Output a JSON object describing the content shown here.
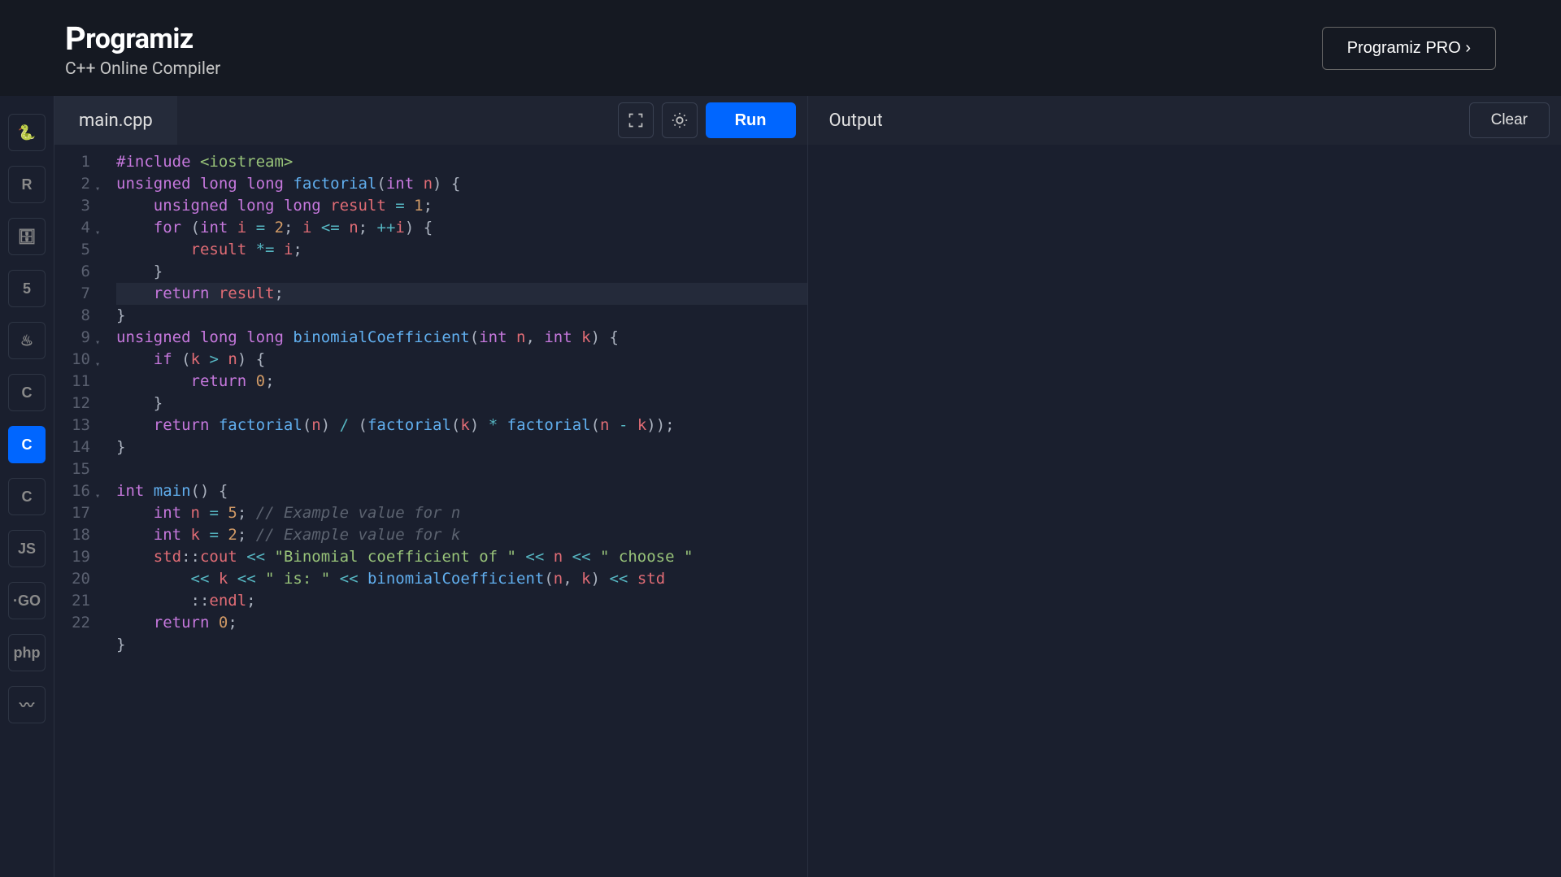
{
  "header": {
    "logo_text": "Programiz",
    "subtitle": "C++ Online Compiler",
    "pro_button": "Programiz PRO ›"
  },
  "sidebar": {
    "languages": [
      {
        "id": "python",
        "glyph": "🐍",
        "active": false
      },
      {
        "id": "r",
        "glyph": "R",
        "active": false
      },
      {
        "id": "sql",
        "glyph": "🗄",
        "active": false
      },
      {
        "id": "html",
        "glyph": "5",
        "active": false
      },
      {
        "id": "java",
        "glyph": "♨",
        "active": false
      },
      {
        "id": "c",
        "glyph": "C",
        "active": false
      },
      {
        "id": "cpp",
        "glyph": "C",
        "active": true
      },
      {
        "id": "csharp",
        "glyph": "C",
        "active": false
      },
      {
        "id": "js",
        "glyph": "JS",
        "active": false
      },
      {
        "id": "go",
        "glyph": "·GO",
        "active": false
      },
      {
        "id": "php",
        "glyph": "php",
        "active": false
      },
      {
        "id": "swift",
        "glyph": "〰",
        "active": false
      }
    ]
  },
  "editor": {
    "filename": "main.cpp",
    "run_label": "Run",
    "line_count": 22,
    "highlighted_line": 7,
    "fold_lines": [
      2,
      4,
      9,
      10,
      16
    ],
    "code_tokens": [
      [
        [
          "tok-pp",
          "#include"
        ],
        [
          "",
          " "
        ],
        [
          "tok-inc",
          "<iostream>"
        ]
      ],
      [
        [
          "tok-type",
          "unsigned"
        ],
        [
          "",
          " "
        ],
        [
          "tok-type",
          "long"
        ],
        [
          "",
          " "
        ],
        [
          "tok-type",
          "long"
        ],
        [
          "",
          " "
        ],
        [
          "tok-fn",
          "factorial"
        ],
        [
          "tok-punc",
          "("
        ],
        [
          "tok-type",
          "int"
        ],
        [
          "",
          " "
        ],
        [
          "tok-id",
          "n"
        ],
        [
          "tok-punc",
          ") {"
        ]
      ],
      [
        [
          "",
          "    "
        ],
        [
          "tok-type",
          "unsigned"
        ],
        [
          "",
          " "
        ],
        [
          "tok-type",
          "long"
        ],
        [
          "",
          " "
        ],
        [
          "tok-type",
          "long"
        ],
        [
          "",
          " "
        ],
        [
          "tok-id",
          "result"
        ],
        [
          "",
          " "
        ],
        [
          "tok-op",
          "="
        ],
        [
          "",
          " "
        ],
        [
          "tok-num",
          "1"
        ],
        [
          "tok-punc",
          ";"
        ]
      ],
      [
        [
          "",
          "    "
        ],
        [
          "tok-kw",
          "for"
        ],
        [
          "",
          " "
        ],
        [
          "tok-punc",
          "("
        ],
        [
          "tok-type",
          "int"
        ],
        [
          "",
          " "
        ],
        [
          "tok-id",
          "i"
        ],
        [
          "",
          " "
        ],
        [
          "tok-op",
          "="
        ],
        [
          "",
          " "
        ],
        [
          "tok-num",
          "2"
        ],
        [
          "tok-punc",
          "; "
        ],
        [
          "tok-id",
          "i"
        ],
        [
          "",
          " "
        ],
        [
          "tok-op",
          "<="
        ],
        [
          "",
          " "
        ],
        [
          "tok-id",
          "n"
        ],
        [
          "tok-punc",
          "; "
        ],
        [
          "tok-op",
          "++"
        ],
        [
          "tok-id",
          "i"
        ],
        [
          "tok-punc",
          ") {"
        ]
      ],
      [
        [
          "",
          "        "
        ],
        [
          "tok-id",
          "result"
        ],
        [
          "",
          " "
        ],
        [
          "tok-op",
          "*="
        ],
        [
          "",
          " "
        ],
        [
          "tok-id",
          "i"
        ],
        [
          "tok-punc",
          ";"
        ]
      ],
      [
        [
          "",
          "    "
        ],
        [
          "tok-punc",
          "}"
        ]
      ],
      [
        [
          "",
          "    "
        ],
        [
          "tok-kw",
          "return"
        ],
        [
          "",
          " "
        ],
        [
          "tok-id",
          "result"
        ],
        [
          "tok-punc",
          ";"
        ]
      ],
      [
        [
          "tok-punc",
          "}"
        ]
      ],
      [
        [
          "tok-type",
          "unsigned"
        ],
        [
          "",
          " "
        ],
        [
          "tok-type",
          "long"
        ],
        [
          "",
          " "
        ],
        [
          "tok-type",
          "long"
        ],
        [
          "",
          " "
        ],
        [
          "tok-fn",
          "binomialCoefficient"
        ],
        [
          "tok-punc",
          "("
        ],
        [
          "tok-type",
          "int"
        ],
        [
          "",
          " "
        ],
        [
          "tok-id",
          "n"
        ],
        [
          "tok-punc",
          ", "
        ],
        [
          "tok-type",
          "int"
        ],
        [
          "",
          " "
        ],
        [
          "tok-id",
          "k"
        ],
        [
          "tok-punc",
          ") {"
        ]
      ],
      [
        [
          "",
          "    "
        ],
        [
          "tok-kw",
          "if"
        ],
        [
          "",
          " "
        ],
        [
          "tok-punc",
          "("
        ],
        [
          "tok-id",
          "k"
        ],
        [
          "",
          " "
        ],
        [
          "tok-op",
          ">"
        ],
        [
          "",
          " "
        ],
        [
          "tok-id",
          "n"
        ],
        [
          "tok-punc",
          ") {"
        ]
      ],
      [
        [
          "",
          "        "
        ],
        [
          "tok-kw",
          "return"
        ],
        [
          "",
          " "
        ],
        [
          "tok-num",
          "0"
        ],
        [
          "tok-punc",
          ";"
        ]
      ],
      [
        [
          "",
          "    "
        ],
        [
          "tok-punc",
          "}"
        ]
      ],
      [
        [
          "",
          "    "
        ],
        [
          "tok-kw",
          "return"
        ],
        [
          "",
          " "
        ],
        [
          "tok-fn",
          "factorial"
        ],
        [
          "tok-punc",
          "("
        ],
        [
          "tok-id",
          "n"
        ],
        [
          "tok-punc",
          ") "
        ],
        [
          "tok-op",
          "/"
        ],
        [
          "",
          " "
        ],
        [
          "tok-punc",
          "("
        ],
        [
          "tok-fn",
          "factorial"
        ],
        [
          "tok-punc",
          "("
        ],
        [
          "tok-id",
          "k"
        ],
        [
          "tok-punc",
          ") "
        ],
        [
          "tok-op",
          "*"
        ],
        [
          "",
          " "
        ],
        [
          "tok-fn",
          "factorial"
        ],
        [
          "tok-punc",
          "("
        ],
        [
          "tok-id",
          "n"
        ],
        [
          "",
          " "
        ],
        [
          "tok-op",
          "-"
        ],
        [
          "",
          " "
        ],
        [
          "tok-id",
          "k"
        ],
        [
          "tok-punc",
          "));"
        ]
      ],
      [
        [
          "tok-punc",
          "}"
        ]
      ],
      [
        [
          "",
          ""
        ]
      ],
      [
        [
          "tok-type",
          "int"
        ],
        [
          "",
          " "
        ],
        [
          "tok-fn",
          "main"
        ],
        [
          "tok-punc",
          "() {"
        ]
      ],
      [
        [
          "",
          "    "
        ],
        [
          "tok-type",
          "int"
        ],
        [
          "",
          " "
        ],
        [
          "tok-id",
          "n"
        ],
        [
          "",
          " "
        ],
        [
          "tok-op",
          "="
        ],
        [
          "",
          " "
        ],
        [
          "tok-num",
          "5"
        ],
        [
          "tok-punc",
          "; "
        ],
        [
          "tok-cmt",
          "// Example value for n"
        ]
      ],
      [
        [
          "",
          "    "
        ],
        [
          "tok-type",
          "int"
        ],
        [
          "",
          " "
        ],
        [
          "tok-id",
          "k"
        ],
        [
          "",
          " "
        ],
        [
          "tok-op",
          "="
        ],
        [
          "",
          " "
        ],
        [
          "tok-num",
          "2"
        ],
        [
          "tok-punc",
          "; "
        ],
        [
          "tok-cmt",
          "// Example value for k"
        ]
      ],
      [
        [
          "",
          "    "
        ],
        [
          "tok-id",
          "std"
        ],
        [
          "tok-punc",
          "::"
        ],
        [
          "tok-id",
          "cout"
        ],
        [
          "",
          " "
        ],
        [
          "tok-op",
          "<<"
        ],
        [
          "",
          " "
        ],
        [
          "tok-str",
          "\"Binomial coefficient of \""
        ],
        [
          "",
          " "
        ],
        [
          "tok-op",
          "<<"
        ],
        [
          "",
          " "
        ],
        [
          "tok-id",
          "n"
        ],
        [
          "",
          " "
        ],
        [
          "tok-op",
          "<<"
        ],
        [
          "",
          " "
        ],
        [
          "tok-str",
          "\" choose \""
        ]
      ],
      [
        [
          "",
          "        "
        ],
        [
          "tok-op",
          "<<"
        ],
        [
          "",
          " "
        ],
        [
          "tok-id",
          "k"
        ],
        [
          "",
          " "
        ],
        [
          "tok-op",
          "<<"
        ],
        [
          "",
          " "
        ],
        [
          "tok-str",
          "\" is: \""
        ],
        [
          "",
          " "
        ],
        [
          "tok-op",
          "<<"
        ],
        [
          "",
          " "
        ],
        [
          "tok-fn",
          "binomialCoefficient"
        ],
        [
          "tok-punc",
          "("
        ],
        [
          "tok-id",
          "n"
        ],
        [
          "tok-punc",
          ", "
        ],
        [
          "tok-id",
          "k"
        ],
        [
          "tok-punc",
          ") "
        ],
        [
          "tok-op",
          "<<"
        ],
        [
          "",
          " "
        ],
        [
          "tok-id",
          "std"
        ]
      ],
      [
        [
          "",
          "        "
        ],
        [
          "tok-punc",
          "::"
        ],
        [
          "tok-id",
          "endl"
        ],
        [
          "tok-punc",
          ";"
        ]
      ],
      [
        [
          "",
          "    "
        ],
        [
          "tok-kw",
          "return"
        ],
        [
          "",
          " "
        ],
        [
          "tok-num",
          "0"
        ],
        [
          "tok-punc",
          ";"
        ]
      ],
      [
        [
          "tok-punc",
          "}"
        ]
      ],
      [
        [
          "",
          ""
        ]
      ]
    ],
    "display_line_numbers": [
      1,
      2,
      3,
      4,
      5,
      6,
      7,
      8,
      9,
      10,
      11,
      12,
      13,
      14,
      15,
      16,
      17,
      18,
      19,
      null,
      null,
      20,
      21,
      22
    ]
  },
  "output": {
    "title": "Output",
    "clear_label": "Clear",
    "content": ""
  }
}
